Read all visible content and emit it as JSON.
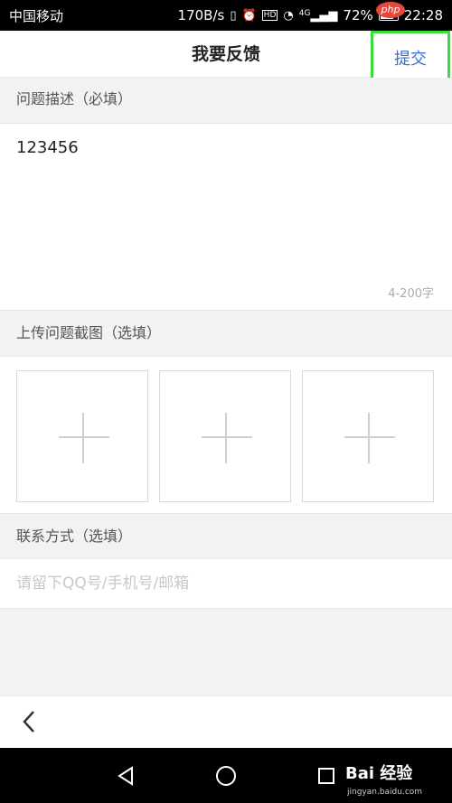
{
  "status_bar": {
    "carrier": "中国移动",
    "speed": "170B/s",
    "battery_percent": "72%",
    "time": "22:28",
    "signal_label": "4G",
    "hd_label": "HD",
    "php_badge": "php"
  },
  "header": {
    "title": "我要反馈",
    "submit_label": "提交"
  },
  "description_section": {
    "label": "问题描述（必填）",
    "value": "123456",
    "char_limit": "4-200字"
  },
  "screenshot_section": {
    "label": "上传问题截图（选填）",
    "slot_count": 3
  },
  "contact_section": {
    "label": "联系方式（选填）",
    "placeholder": "请留下QQ号/手机号/邮箱"
  },
  "watermark": {
    "text": "Bai 经验",
    "sub": "jingyan.baidu.com"
  },
  "colors": {
    "accent_blue": "#3a6fd8",
    "highlight_green": "#3ddc3d"
  }
}
